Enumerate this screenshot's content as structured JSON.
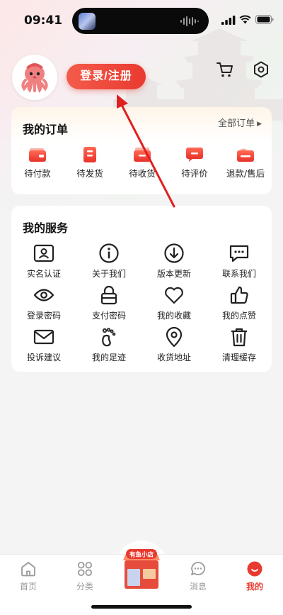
{
  "status_bar": {
    "time": "09:41"
  },
  "header": {
    "login_label": "登录/注册"
  },
  "orders": {
    "title": "我的订单",
    "all_orders": "全部订单",
    "items": [
      {
        "label": "待付款",
        "icon": "wallet-icon"
      },
      {
        "label": "待发货",
        "icon": "package-icon"
      },
      {
        "label": "待收货",
        "icon": "delivery-box-icon"
      },
      {
        "label": "待评价",
        "icon": "comment-icon"
      },
      {
        "label": "退款/售后",
        "icon": "refund-icon"
      }
    ]
  },
  "services": {
    "title": "我的服务",
    "items": [
      {
        "label": "实名认证",
        "icon": "id-card-icon"
      },
      {
        "label": "关于我们",
        "icon": "info-icon"
      },
      {
        "label": "版本更新",
        "icon": "download-icon"
      },
      {
        "label": "联系我们",
        "icon": "chat-icon"
      },
      {
        "label": "登录密码",
        "icon": "eye-icon"
      },
      {
        "label": "支付密码",
        "icon": "lock-icon"
      },
      {
        "label": "我的收藏",
        "icon": "heart-icon"
      },
      {
        "label": "我的点赞",
        "icon": "thumbs-up-icon"
      },
      {
        "label": "投诉建议",
        "icon": "mail-icon"
      },
      {
        "label": "我的足迹",
        "icon": "footprint-icon"
      },
      {
        "label": "收货地址",
        "icon": "location-icon"
      },
      {
        "label": "清理缓存",
        "icon": "trash-icon"
      }
    ]
  },
  "tab_bar": {
    "tabs": [
      {
        "label": "首页",
        "icon": "home-icon"
      },
      {
        "label": "分类",
        "icon": "category-icon"
      },
      {
        "label": "消息",
        "icon": "message-icon"
      },
      {
        "label": "我的",
        "icon": "profile-icon",
        "active": true
      }
    ],
    "shop_sign": "有鱼小店"
  },
  "colors": {
    "accent": "#e93a30",
    "accent_light": "#f45b4a",
    "text": "#222222",
    "muted": "#999999"
  }
}
